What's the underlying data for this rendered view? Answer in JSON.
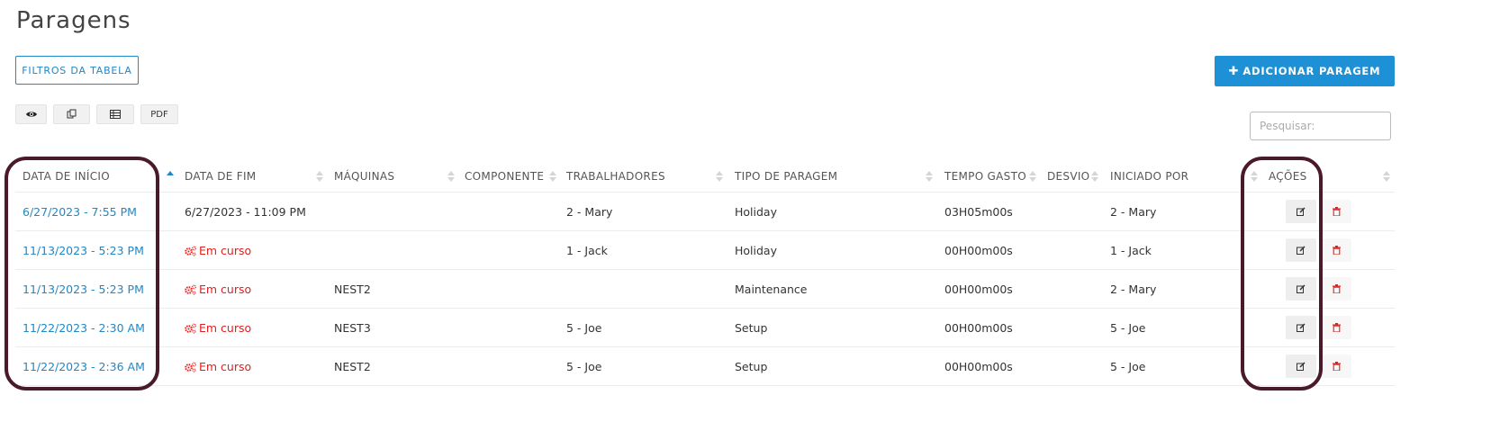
{
  "page": {
    "title": "Paragens"
  },
  "toolbar": {
    "filters_label": "FILTROS DA TABELA",
    "add_label": "ADICIONAR PARAGEM",
    "add_icon": "plus-icon",
    "export_buttons": [
      {
        "icon": "eye-icon"
      },
      {
        "icon": "copy-icon"
      },
      {
        "icon": "table-icon"
      },
      {
        "label": "PDF"
      }
    ],
    "search_placeholder": "Pesquisar:"
  },
  "table": {
    "columns": [
      "DATA DE INÍCIO",
      "DATA DE FIM",
      "MÁQUINAS",
      "COMPONENTE",
      "TRABALHADORES",
      "TIPO DE PARAGEM",
      "TEMPO GASTO",
      "DESVIO",
      "INICIADO POR",
      "AÇÕES"
    ],
    "sorted_column": "DATA DE INÍCIO",
    "sort_direction": "ascending",
    "rows": [
      {
        "start": "6/27/2023 - 7:55 PM",
        "end": "6/27/2023 - 11:09 PM",
        "end_running": false,
        "machines": "",
        "component": "",
        "workers": "2 - Mary",
        "type": "Holiday",
        "time_spent": "03H05m00s",
        "deviation": "",
        "started_by": "2 - Mary"
      },
      {
        "start": "11/13/2023 - 5:23 PM",
        "end": "Em curso",
        "end_running": true,
        "machines": "",
        "component": "",
        "workers": "1 - Jack",
        "type": "Holiday",
        "time_spent": "00H00m00s",
        "deviation": "",
        "started_by": "1 - Jack"
      },
      {
        "start": "11/13/2023 - 5:23 PM",
        "end": "Em curso",
        "end_running": true,
        "machines": "NEST2",
        "component": "",
        "workers": "",
        "type": "Maintenance",
        "time_spent": "00H00m00s",
        "deviation": "",
        "started_by": "2 - Mary"
      },
      {
        "start": "11/22/2023 - 2:30 AM",
        "end": "Em curso",
        "end_running": true,
        "machines": "NEST3",
        "component": "",
        "workers": "5 - Joe",
        "type": "Setup",
        "time_spent": "00H00m00s",
        "deviation": "",
        "started_by": "5 - Joe"
      },
      {
        "start": "11/22/2023 - 2:36 AM",
        "end": "Em curso",
        "end_running": true,
        "machines": "NEST2",
        "component": "",
        "workers": "5 - Joe",
        "type": "Setup",
        "time_spent": "00H00m00s",
        "deviation": "",
        "started_by": "5 - Joe"
      }
    ],
    "row_actions": [
      {
        "icon": "edit-icon"
      },
      {
        "icon": "trash-icon"
      }
    ]
  },
  "colors": {
    "accent": "#1e88c9",
    "button_primary": "#1e90d6",
    "running_text": "#e0201d",
    "delete_icon": "#e0201d",
    "highlight_outline": "#4a1a2c"
  }
}
